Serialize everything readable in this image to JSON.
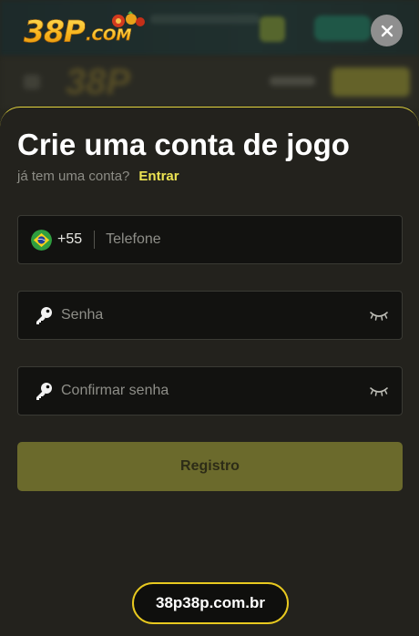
{
  "background": {
    "logo_text": "38P"
  },
  "header": {
    "logo_main": "38P",
    "logo_suffix": ".COM"
  },
  "modal": {
    "title": "Crie uma conta de jogo",
    "have_account_text": "já tem uma conta?",
    "login_link": "Entrar",
    "phone": {
      "country_code": "+55",
      "country_icon": "brazil-flag-icon",
      "placeholder": "Telefone",
      "value": ""
    },
    "password": {
      "placeholder": "Senha",
      "value": "",
      "icon": "key-icon",
      "toggle_icon": "eye-closed-icon"
    },
    "confirm_password": {
      "placeholder": "Confirmar senha",
      "value": "",
      "icon": "key-icon",
      "toggle_icon": "eye-closed-icon"
    },
    "register_label": "Registro"
  },
  "footer": {
    "domain": "38p38p.com.br"
  },
  "colors": {
    "accent": "#ece352",
    "button": "#6b6a2c",
    "sheet": "#23221d",
    "field": "#121210",
    "pill_border": "#e8c91f"
  }
}
